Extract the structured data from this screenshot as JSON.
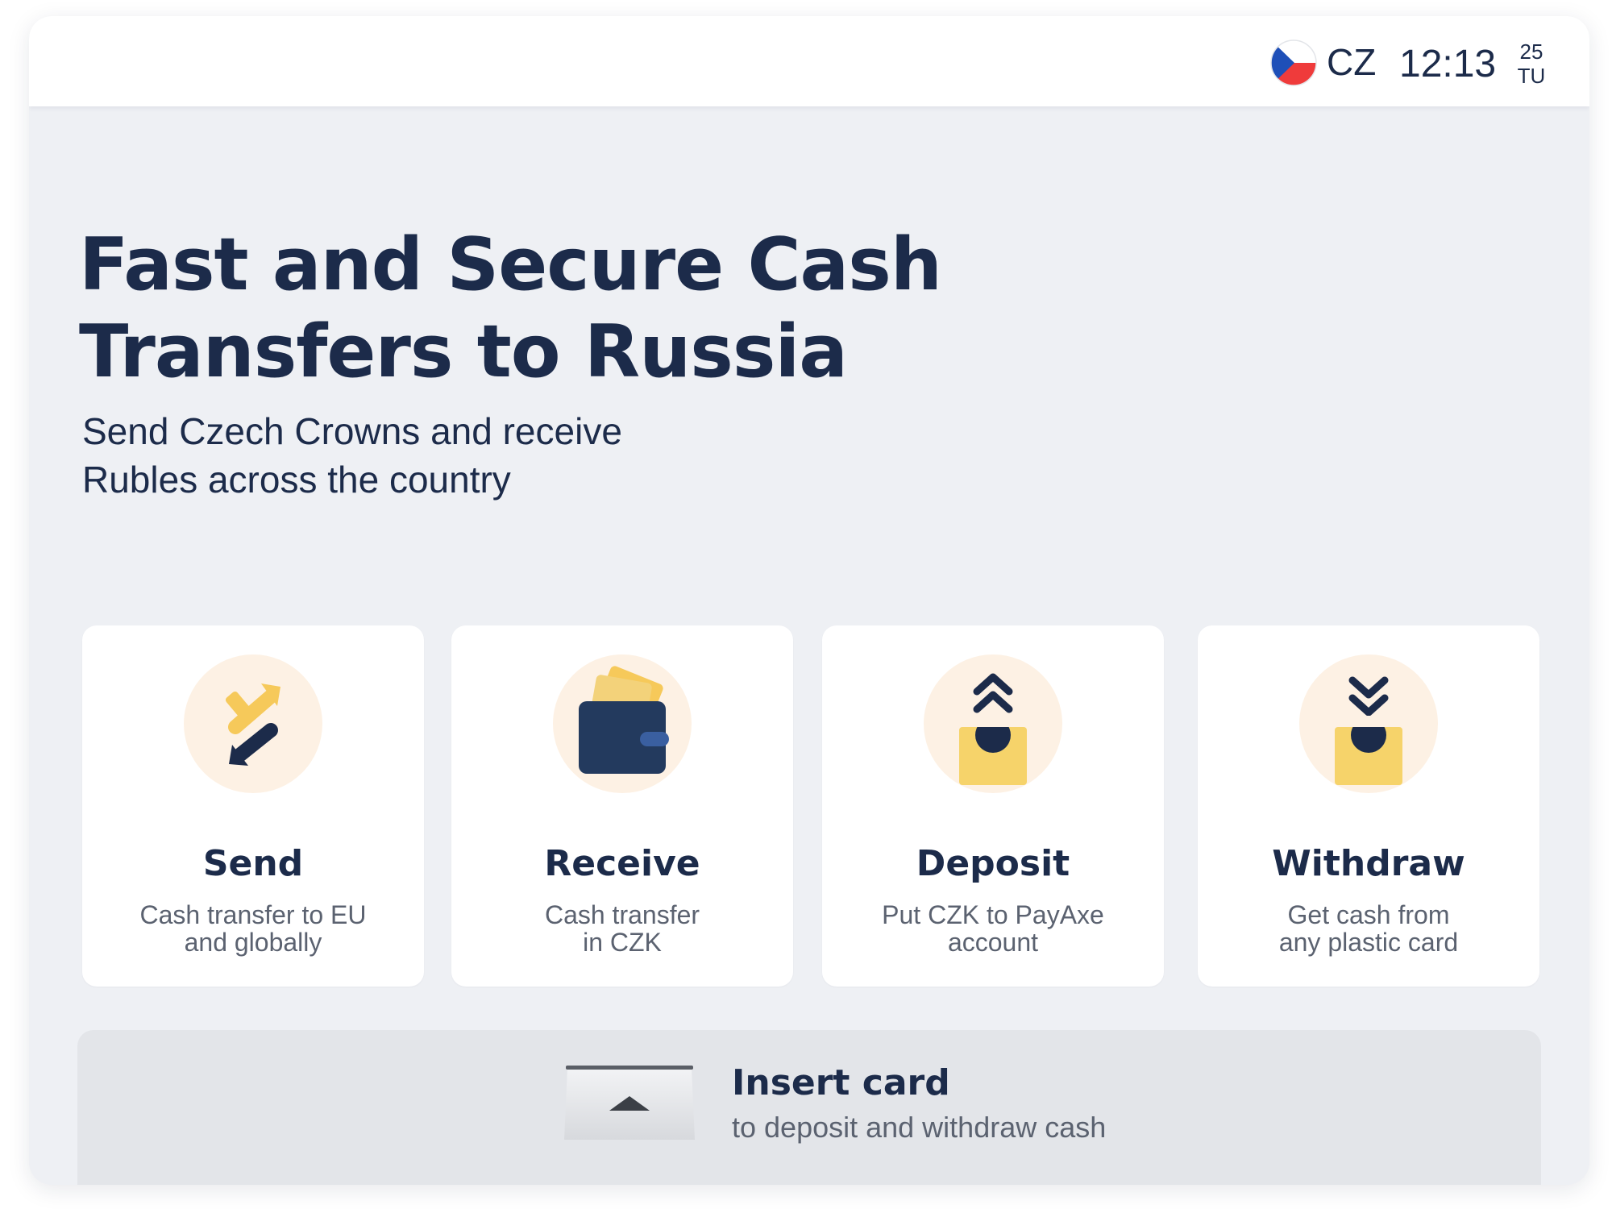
{
  "status_bar": {
    "language_code": "CZ",
    "time": "12:13",
    "date_day": "25",
    "date_weekday": "TU",
    "flag_icon": "czech-flag-icon"
  },
  "hero": {
    "title_line1": "Fast and Secure Cash",
    "title_line2": "Transfers to Russia",
    "subtitle_line1": "Send Czech Crowns and receive",
    "subtitle_line2": "Rubles across the country"
  },
  "actions": [
    {
      "title": "Send",
      "desc_line1": "Cash transfer to EU",
      "desc_line2": "and globally",
      "icon": "send-transfer-icon"
    },
    {
      "title": "Receive",
      "desc_line1": "Cash transfer",
      "desc_line2": "in CZK",
      "icon": "wallet-icon"
    },
    {
      "title": "Deposit",
      "desc_line1": "Put CZK to PayAxe",
      "desc_line2": "account",
      "icon": "deposit-icon"
    },
    {
      "title": "Withdraw",
      "desc_line1": "Get cash from",
      "desc_line2": "any plastic card",
      "icon": "withdraw-icon"
    }
  ],
  "insert_card": {
    "title": "Insert card",
    "subtitle": "to deposit and withdraw cash",
    "icon": "card-slot-icon"
  },
  "colors": {
    "navy": "#1c2b4a",
    "accent_yellow": "#f6c95a",
    "icon_bg": "#fdf1e4",
    "background": "#eef0f4",
    "flag_blue": "#1e4fb8",
    "flag_red": "#ef3b3b"
  }
}
